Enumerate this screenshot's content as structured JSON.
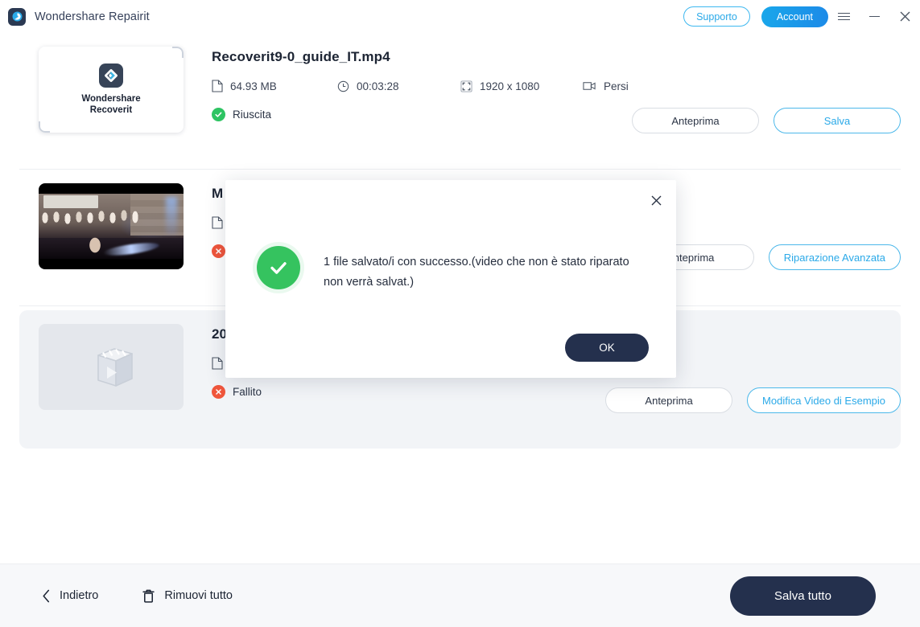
{
  "window": {
    "app_title": "Wondershare Repairit",
    "logo_icon": "wondershare-logo-icon",
    "support_label": "Supporto",
    "account_label": "Account",
    "menu_icon": "hamburger-menu-icon",
    "minimize_icon": "minimize-icon",
    "close_icon": "close-icon"
  },
  "files": [
    {
      "name": "Recoverit9-0_guide_IT.mp4",
      "thumbnail_kind": "recoverit-logo-card",
      "thumbnail_caption_line1": "Wondershare",
      "thumbnail_caption_line2": "Recoverit",
      "size": "64.93  MB",
      "duration": "00:03:28",
      "resolution": "1920 x 1080",
      "source": "Persi",
      "status": "Riuscita",
      "status_type": "success",
      "buttons": [
        {
          "label": "Anteprima",
          "style": "neutral"
        },
        {
          "label": "Salva",
          "style": "primary-outline"
        }
      ]
    },
    {
      "name": "M",
      "thumbnail_kind": "video-frame",
      "size": "",
      "duration": "",
      "resolution": "",
      "source": "",
      "status": "",
      "status_type": "fail",
      "buttons": [
        {
          "label": "Anteprima",
          "style": "neutral"
        },
        {
          "label": "Riparazione Avanzata",
          "style": "primary-outline"
        }
      ]
    },
    {
      "name": "20",
      "thumbnail_kind": "placeholder",
      "size": "",
      "duration": "",
      "resolution": "",
      "source": "",
      "status": "Fallito",
      "status_type": "fail",
      "buttons": [
        {
          "label": "Anteprima",
          "style": "neutral"
        },
        {
          "label": "Modifica Video di Esempio",
          "style": "primary-outline"
        }
      ]
    }
  ],
  "meta_icons": {
    "size_icon": "file-icon",
    "duration_icon": "clock-icon",
    "resolution_icon": "resize-icon",
    "source_icon": "video-camera-icon"
  },
  "footer": {
    "back_label": "Indietro",
    "back_icon": "chevron-left-icon",
    "remove_all_label": "Rimuovi tutto",
    "remove_all_icon": "trash-icon",
    "save_all_label": "Salva tutto"
  },
  "dialog": {
    "message": "1 file salvato/i con successo.(video che non è stato riparato non verrà salvat.)",
    "ok_label": "OK",
    "close_icon": "close-icon",
    "status_icon": "check-circle-icon"
  },
  "colors": {
    "accent_blue": "#2aa9e8",
    "dark_navy": "#24304d",
    "success_green": "#2ec463",
    "error_red": "#f0563c",
    "selected_row": "#f2f4f7"
  }
}
